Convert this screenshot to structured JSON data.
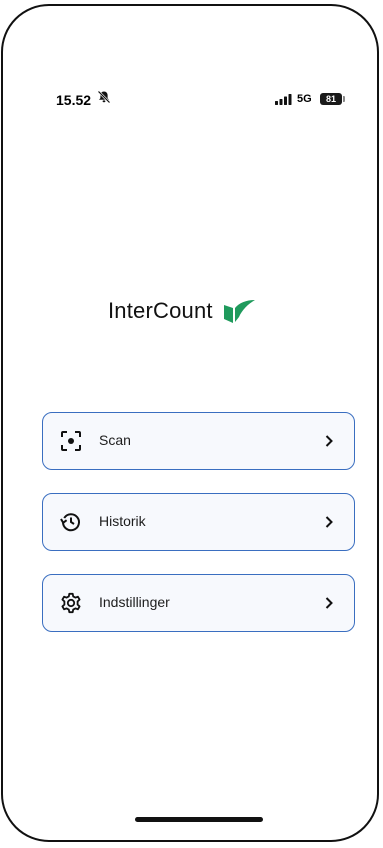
{
  "status_bar": {
    "time": "15.52",
    "network": "5G",
    "battery": "81"
  },
  "brand": {
    "name": "InterCount",
    "accent_color": "#1f9a5c"
  },
  "menu": [
    {
      "label": "Scan",
      "icon": "scan-icon"
    },
    {
      "label": "Historik",
      "icon": "history-icon"
    },
    {
      "label": "Indstillinger",
      "icon": "gear-icon"
    }
  ],
  "colors": {
    "button_border": "#3a6ec0",
    "button_background": "#f7f9fd"
  }
}
